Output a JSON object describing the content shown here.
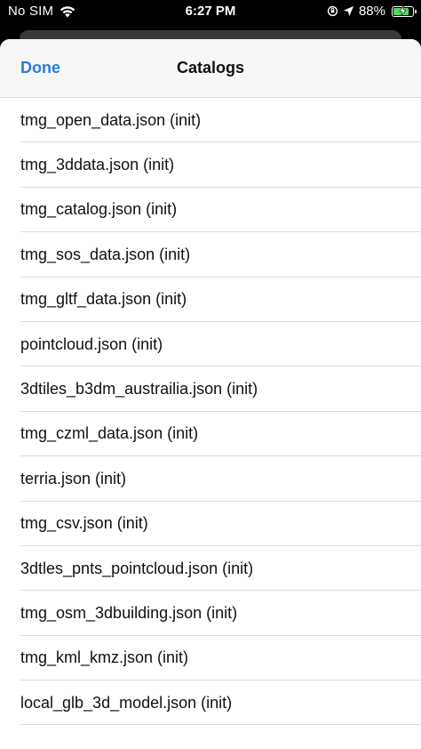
{
  "status_bar": {
    "carrier": "No SIM",
    "time": "6:27 PM",
    "battery_percent": "88%",
    "battery_level": 0.88,
    "icons": [
      "wifi-icon",
      "orientation-lock-icon",
      "location-arrow-icon",
      "battery-charging-icon"
    ]
  },
  "nav": {
    "done_label": "Done",
    "title": "Catalogs"
  },
  "catalogs": [
    "tmg_open_data.json (init)",
    "tmg_3ddata.json (init)",
    "tmg_catalog.json (init)",
    "tmg_sos_data.json (init)",
    "tmg_gltf_data.json (init)",
    "pointcloud.json (init)",
    "3dtiles_b3dm_austrailia.json (init)",
    "tmg_czml_data.json (init)",
    "terria.json (init)",
    "tmg_csv.json (init)",
    "3dtles_pnts_pointcloud.json (init)",
    "tmg_osm_3dbuilding.json (init)",
    "tmg_kml_kmz.json (init)",
    "local_glb_3d_model.json (init)"
  ],
  "colors": {
    "accent": "#2f7bd4",
    "battery": "#4cd964"
  }
}
